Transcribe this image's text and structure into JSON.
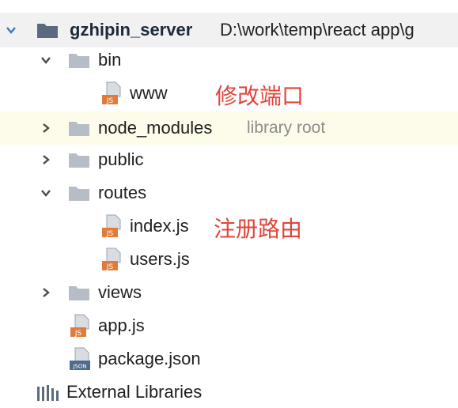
{
  "tree": {
    "root": {
      "name": "gzhipin_server",
      "path": "D:\\work\\temp\\react app\\g"
    },
    "items": [
      {
        "label": "bin",
        "kind": "folder",
        "state": "expanded"
      },
      {
        "label": "www",
        "kind": "file",
        "badge": "JS"
      },
      {
        "label": "node_modules",
        "kind": "folder",
        "state": "collapsed",
        "suffix": "library root"
      },
      {
        "label": "public",
        "kind": "folder",
        "state": "collapsed"
      },
      {
        "label": "routes",
        "kind": "folder",
        "state": "expanded"
      },
      {
        "label": "index.js",
        "kind": "file",
        "badge": "JS"
      },
      {
        "label": "users.js",
        "kind": "file",
        "badge": "JS"
      },
      {
        "label": "views",
        "kind": "folder",
        "state": "collapsed"
      },
      {
        "label": "app.js",
        "kind": "file",
        "badge": "JS"
      },
      {
        "label": "package.json",
        "kind": "file",
        "badge": "JSON"
      },
      {
        "label": "External Libraries",
        "kind": "libraries"
      }
    ]
  },
  "annotations": {
    "www": "修改端口",
    "index": "注册路由"
  },
  "colors": {
    "annotation": "#e0463a",
    "folder": "#b6bdc6",
    "file_badge": "#e07b3a",
    "chevron": "#4a4a4a",
    "highlight_row": "#fdfbea"
  }
}
